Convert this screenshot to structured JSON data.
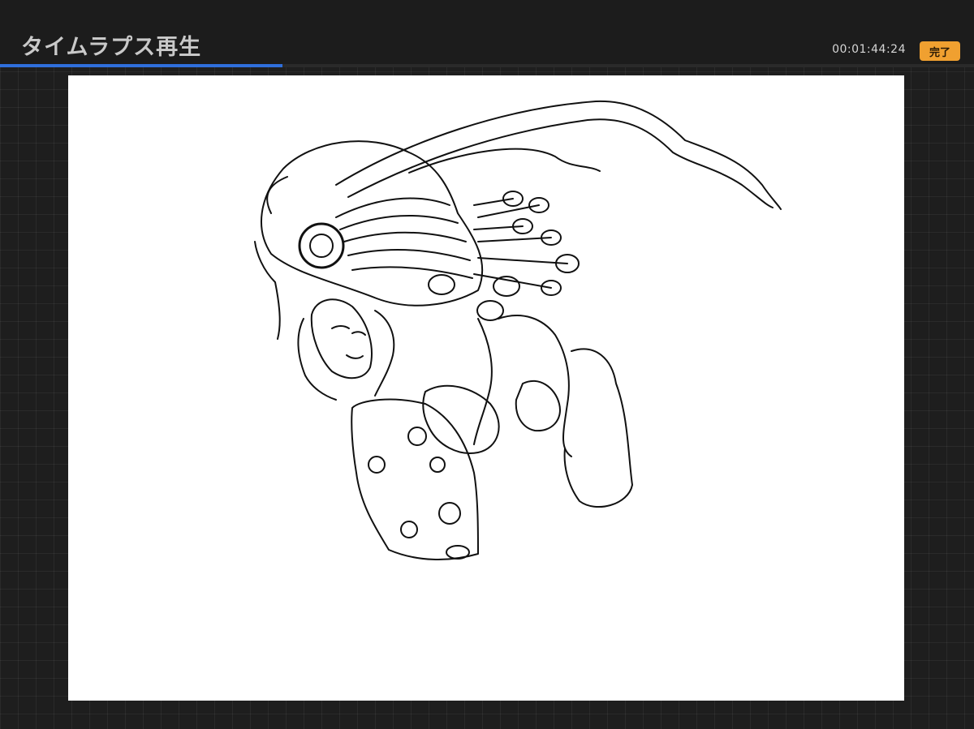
{
  "header": {
    "title": "タイムラプス再生",
    "timecode": "00:01:44:24",
    "done_label": "完了"
  },
  "playback": {
    "progress_fraction": 0.29
  },
  "canvas": {
    "subject": "ink-line-drawing-owl-helmet-character"
  },
  "colors": {
    "background": "#1e1e1e",
    "accent_button": "#f0a030",
    "progress": "#2f6fdc",
    "canvas": "#ffffff",
    "ink": "#111111"
  }
}
